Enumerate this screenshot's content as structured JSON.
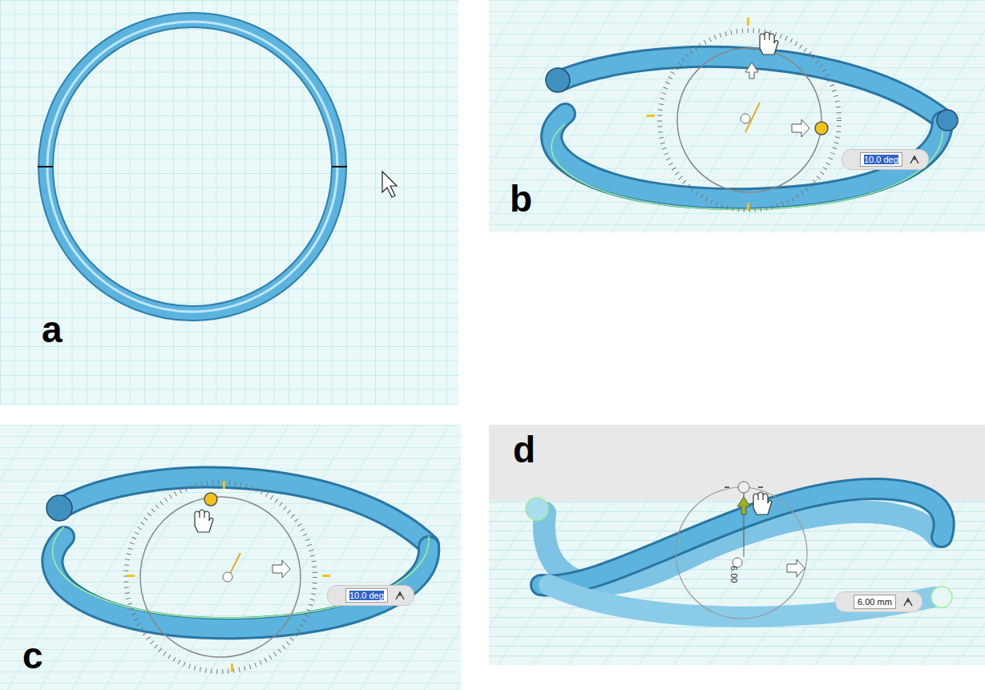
{
  "figure": {
    "panels": [
      {
        "label": "a",
        "kind": "top-view"
      },
      {
        "label": "b",
        "kind": "rotate",
        "input": {
          "value": "10.0 deg",
          "selected": true
        }
      },
      {
        "label": "c",
        "kind": "rotate-lower",
        "input": {
          "value": "10.0 deg",
          "selected": true
        }
      },
      {
        "label": "d",
        "kind": "move",
        "input": {
          "value": "6.00 mm",
          "selected": false
        },
        "dimension": "6.00"
      }
    ]
  }
}
